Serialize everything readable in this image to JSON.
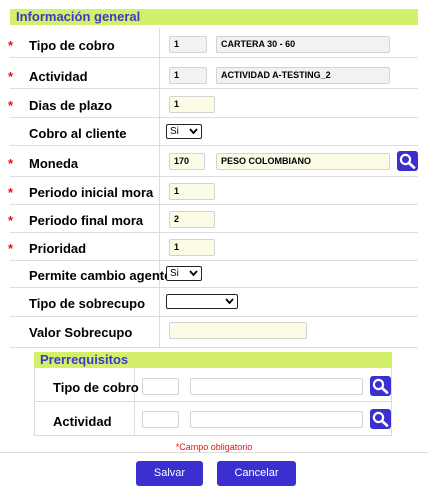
{
  "general": {
    "title": "Información general",
    "required_marker": "*",
    "tipo_cobro": {
      "label": "Tipo de cobro",
      "code": "1",
      "description": "CARTERA 30 - 60"
    },
    "actividad": {
      "label": "Actividad",
      "code": "1",
      "description": "ACTIVIDAD A-TESTING_2"
    },
    "dias_plazo": {
      "label": "Dias de plazo",
      "value": "1"
    },
    "cobro_cliente": {
      "label": "Cobro al cliente",
      "selected": "Si"
    },
    "moneda": {
      "label": "Moneda",
      "code": "170",
      "description": "PESO COLOMBIANO"
    },
    "periodo_inicial": {
      "label": "Periodo inicial mora",
      "value": "1"
    },
    "periodo_final": {
      "label": "Periodo final mora",
      "value": "2"
    },
    "prioridad": {
      "label": "Prioridad",
      "value": "1"
    },
    "permite_cambio": {
      "label": "Permite cambio agente",
      "selected": "Si"
    },
    "tipo_sobrecupo": {
      "label": "Tipo de sobrecupo",
      "selected": ""
    },
    "valor_sobrecupo": {
      "label": "Valor Sobrecupo",
      "value": ""
    }
  },
  "prerrequisitos": {
    "title": "Prerrequisitos",
    "tipo_cobro": {
      "label": "Tipo de cobro",
      "code": "",
      "description": ""
    },
    "actividad": {
      "label": "Actividad",
      "code": "",
      "description": ""
    }
  },
  "footer": {
    "required_note_marker": "*",
    "required_note": "Campo obligatorio",
    "save_label": "Salvar",
    "cancel_label": "Cancelar"
  },
  "icons": {
    "search": "search-icon",
    "dropdown": "chevron-down-icon"
  },
  "colors": {
    "section_bg": "#d4ef6c",
    "section_text": "#3a3ac8",
    "button": "#3b2fd0",
    "required": "#e1121b"
  }
}
